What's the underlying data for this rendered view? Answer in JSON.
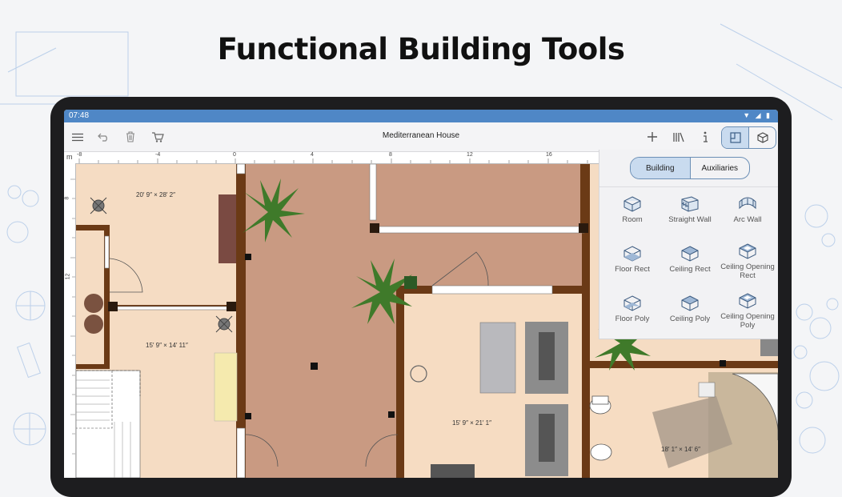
{
  "headline": "Functional Building Tools",
  "status_bar": {
    "time": "07:48"
  },
  "toolbar": {
    "document_title": "Mediterranean House",
    "menu_icon": "menu-icon",
    "undo_icon": "undo-icon",
    "delete_icon": "trash-icon",
    "cart_icon": "cart-icon",
    "add_icon": "plus-icon",
    "library_icon": "library-icon",
    "info_icon": "info-icon",
    "view_2d_icon": "plan-2d-icon",
    "view_3d_icon": "cube-3d-icon"
  },
  "ruler": {
    "unit": "m",
    "top_labels": [
      "-8",
      "-4",
      "0",
      "4",
      "8",
      "12",
      "16"
    ],
    "left_labels": [
      "8",
      "12"
    ]
  },
  "panel": {
    "tabs": [
      {
        "label": "Building",
        "active": true
      },
      {
        "label": "Auxiliaries",
        "active": false
      }
    ],
    "tools": [
      {
        "label": "Room",
        "icon": "room-icon"
      },
      {
        "label": "Straight Wall",
        "icon": "straight-wall-icon"
      },
      {
        "label": "Arc Wall",
        "icon": "arc-wall-icon"
      },
      {
        "label": "Floor Rect",
        "icon": "floor-rect-icon"
      },
      {
        "label": "Ceiling Rect",
        "icon": "ceiling-rect-icon"
      },
      {
        "label": "Ceiling Opening Rect",
        "icon": "ceiling-opening-rect-icon"
      },
      {
        "label": "Floor Poly",
        "icon": "floor-poly-icon"
      },
      {
        "label": "Ceiling Poly",
        "icon": "ceiling-poly-icon"
      },
      {
        "label": "Ceiling Opening Poly",
        "icon": "ceiling-opening-poly-icon"
      }
    ]
  },
  "plan_dimensions": [
    "20′ 9″ × 28′ 2″",
    "15′ 9″ × 14′ 11″",
    "15′ 9″ × 21′ 1″",
    "18′ 1″ × 14′ 6″"
  ],
  "colors": {
    "accent": "#4f87c6",
    "wall": "#6b3a16",
    "floor_light": "#f6dcc2",
    "floor_dark": "#c99a82"
  }
}
